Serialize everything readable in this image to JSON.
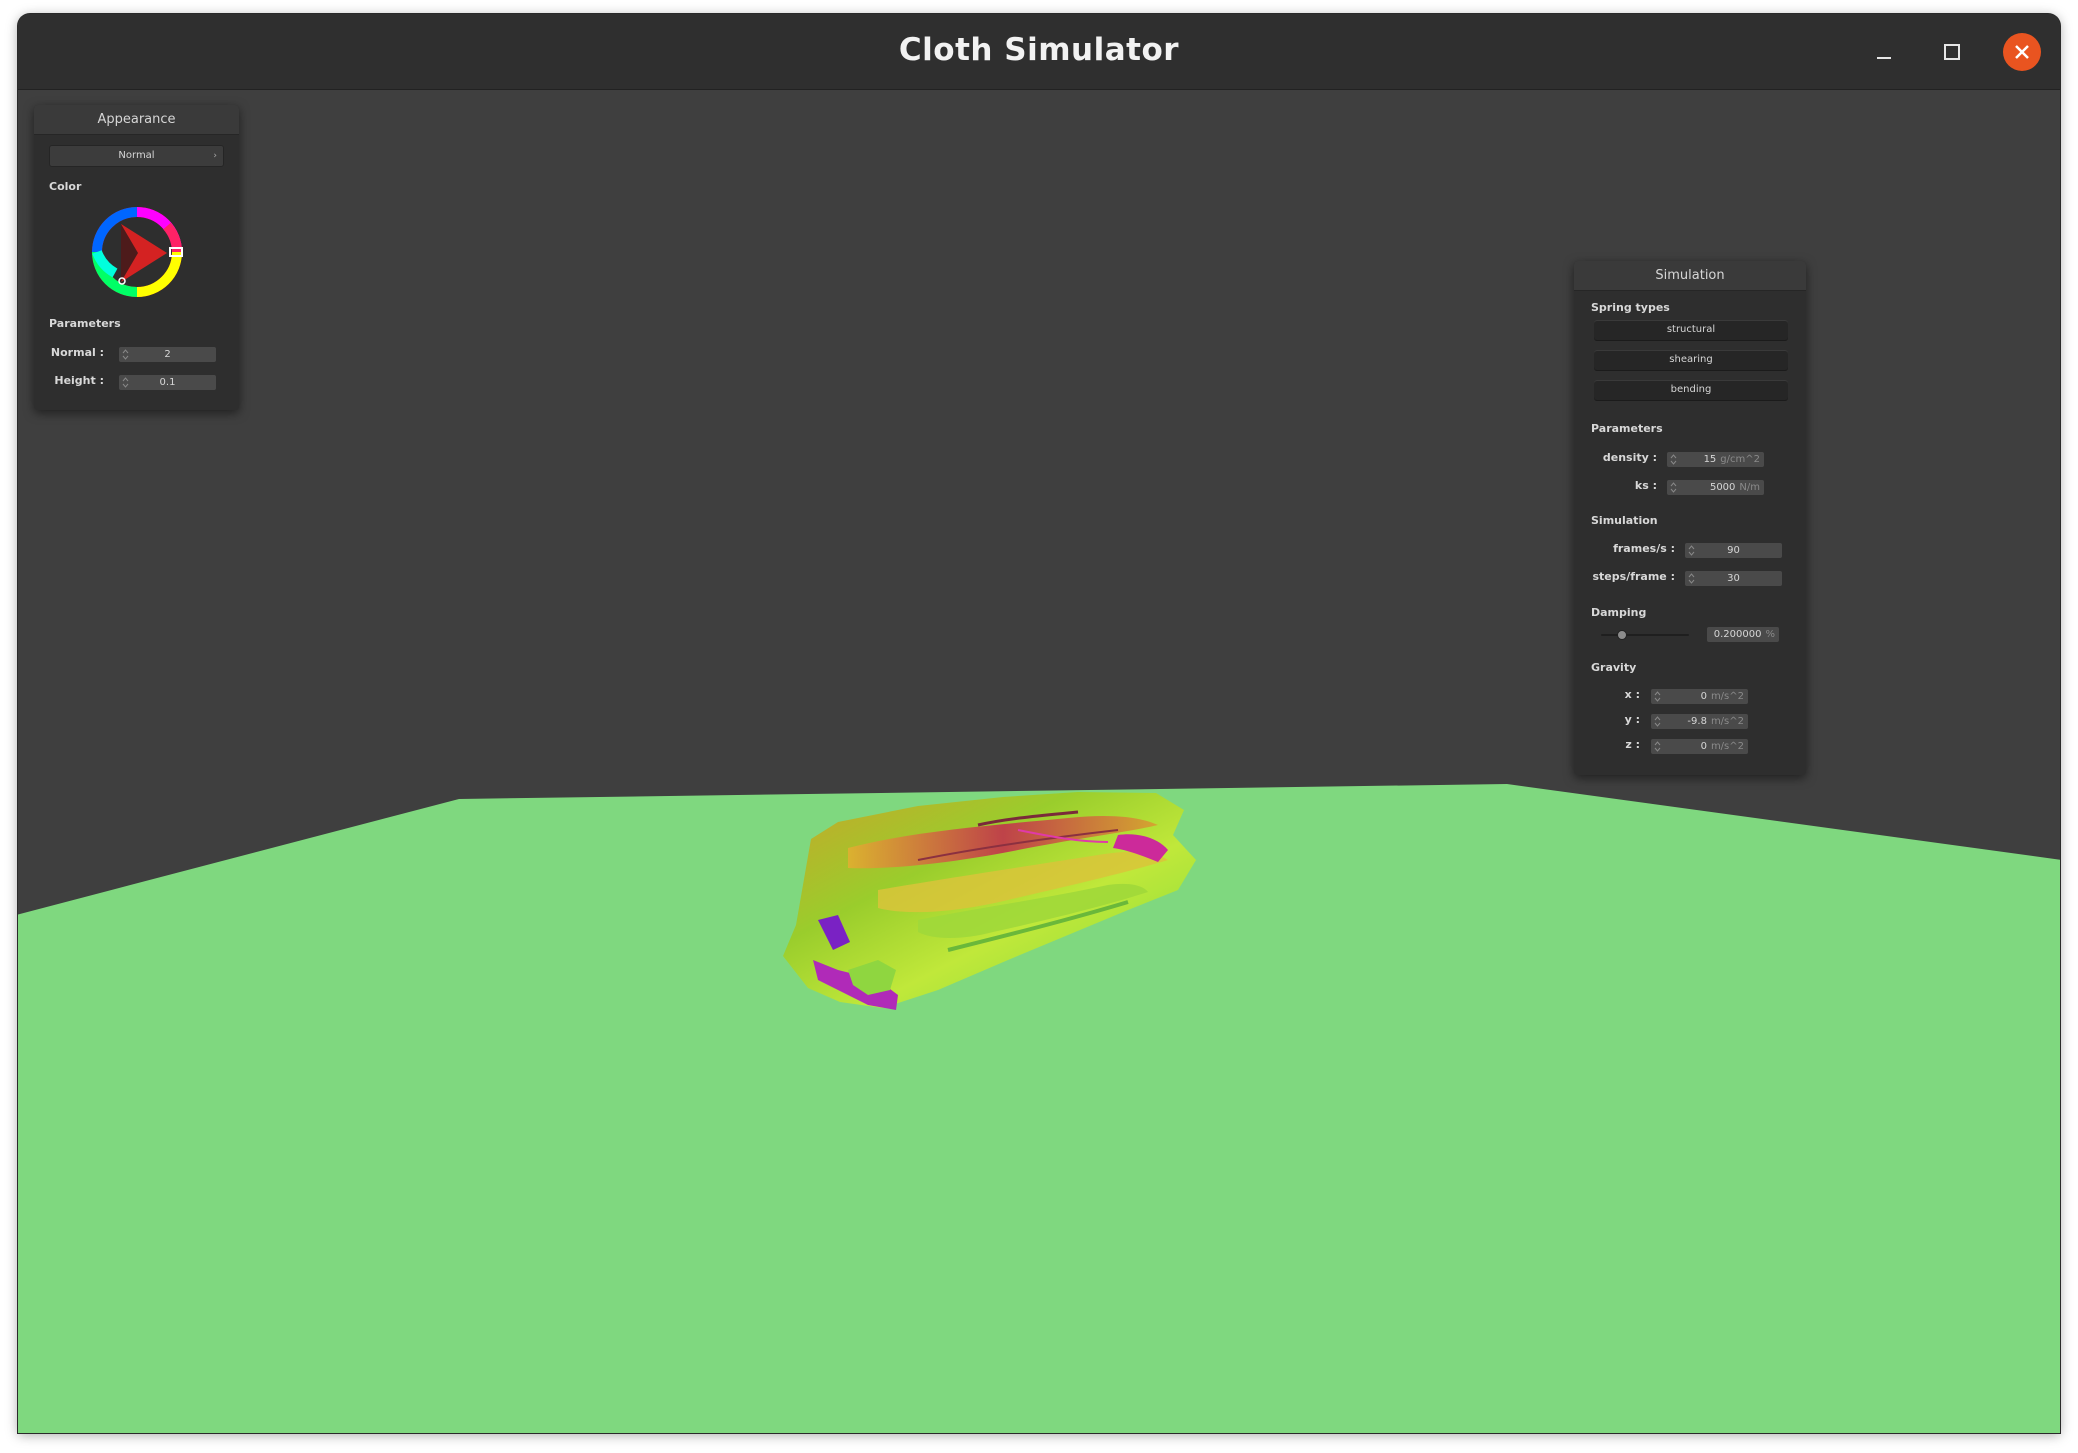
{
  "window": {
    "title": "Cloth Simulator",
    "controls": {
      "minimize_icon": "minimize-icon",
      "maximize_icon": "maximize-icon",
      "close_icon": "close-icon"
    }
  },
  "scene": {
    "background": "#3f3f3f",
    "floor_color": "#7fd87f"
  },
  "appearance_panel": {
    "title": "Appearance",
    "mode_select": "Normal",
    "color_label": "Color",
    "parameters_label": "Parameters",
    "normal_label": "Normal :",
    "normal_value": "2",
    "height_label": "Height :",
    "height_value": "0.1"
  },
  "simulation_panel": {
    "title": "Simulation",
    "spring_types_label": "Spring types",
    "spring_buttons": [
      "structural",
      "shearing",
      "bending"
    ],
    "parameters_label": "Parameters",
    "density_label": "density :",
    "density_value": "15",
    "density_unit": "g/cm^2",
    "ks_label": "ks :",
    "ks_value": "5000",
    "ks_unit": "N/m",
    "simulation_label": "Simulation",
    "fps_label": "frames/s :",
    "fps_value": "90",
    "steps_label": "steps/frame :",
    "steps_value": "30",
    "damping_label": "Damping",
    "damping_value": "0.200000",
    "damping_unit": "%",
    "damping_fraction": 0.2,
    "gravity_label": "Gravity",
    "gx_label": "x :",
    "gx_value": "0",
    "gy_label": "y :",
    "gy_value": "-9.8",
    "gz_label": "z :",
    "gz_value": "0",
    "gravity_unit": "m/s^2"
  }
}
